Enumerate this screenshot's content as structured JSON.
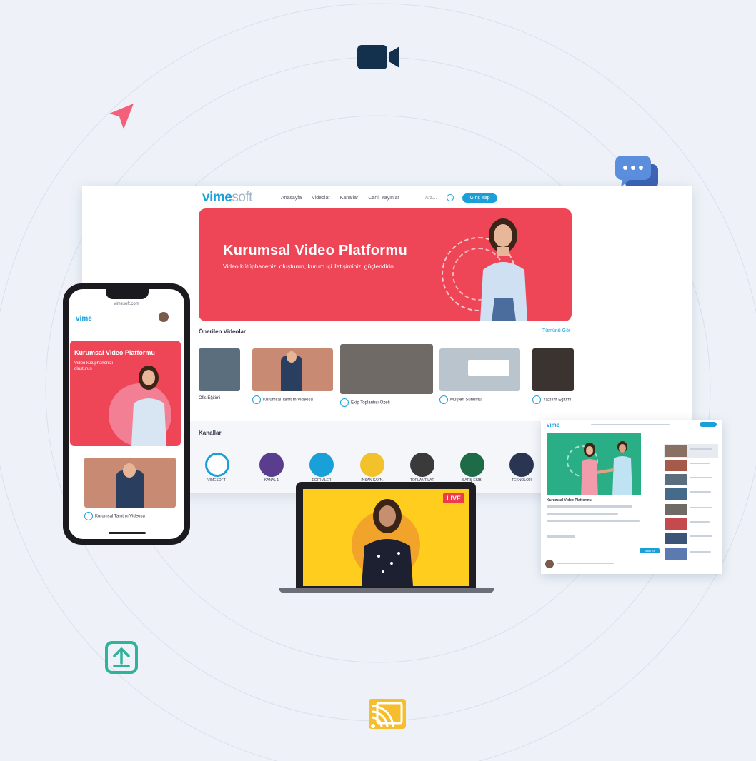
{
  "colors": {
    "background": "#eef2f8",
    "brand": "#1aa0d8",
    "hero_red": "#ef4657",
    "video_icon": "#13304d",
    "send_icon": "#f2607a",
    "chat_icon": "#4a78c9",
    "upload_icon": "#2fb39a",
    "cast_icon": "#f6be2c",
    "laptop_yellow": "#ffcd1e"
  },
  "icons": [
    "video-camera-icon",
    "send-arrow-icon",
    "chat-bubble-icon",
    "upload-icon",
    "cast-icon"
  ],
  "desktop": {
    "logo_main": "vime",
    "logo_soft": "soft",
    "nav": [
      "Anasayfa",
      "Videolar",
      "Kanallar",
      "Canlı Yayınlar"
    ],
    "search_placeholder": "Ara...",
    "login": "Giriş Yap",
    "hero_title": "Kurumsal Video Platformu",
    "hero_subtitle": "Video kütüphanenizi oluşturun, kurum içi iletişiminizi güçlendirin.",
    "section_videos": "Önerilen Videolar",
    "see_all": "Tümünü Gör",
    "video_captions": [
      "Ofis Eğitimi",
      "Kurumsal Tanıtım Videosu",
      "Ekip Toplantısı Özeti",
      "Müşteri Sunumu",
      "Yazılım Eğitimi"
    ],
    "section_channels": "Kanallar",
    "channels": [
      "VIMESOFT",
      "KANAL 1",
      "EĞİTİMLER",
      "İNSAN KAYN.",
      "TOPLANTILAR",
      "SATIŞ EKİBİ",
      "TEKNOLOJİ"
    ]
  },
  "phone": {
    "url": "vimesoft.com",
    "logo": "vime",
    "hero_title": "Kurumsal Video Platformu",
    "hero_text": "Video kütüphanenizi oluşturun",
    "card_caption": "Kurumsal Tanıtım Videosu"
  },
  "laptop": {
    "live_badge": "LIVE"
  },
  "tablet": {
    "logo": "vime",
    "video_title": "Kurumsal Video Platformu",
    "button": "Takip Et"
  }
}
